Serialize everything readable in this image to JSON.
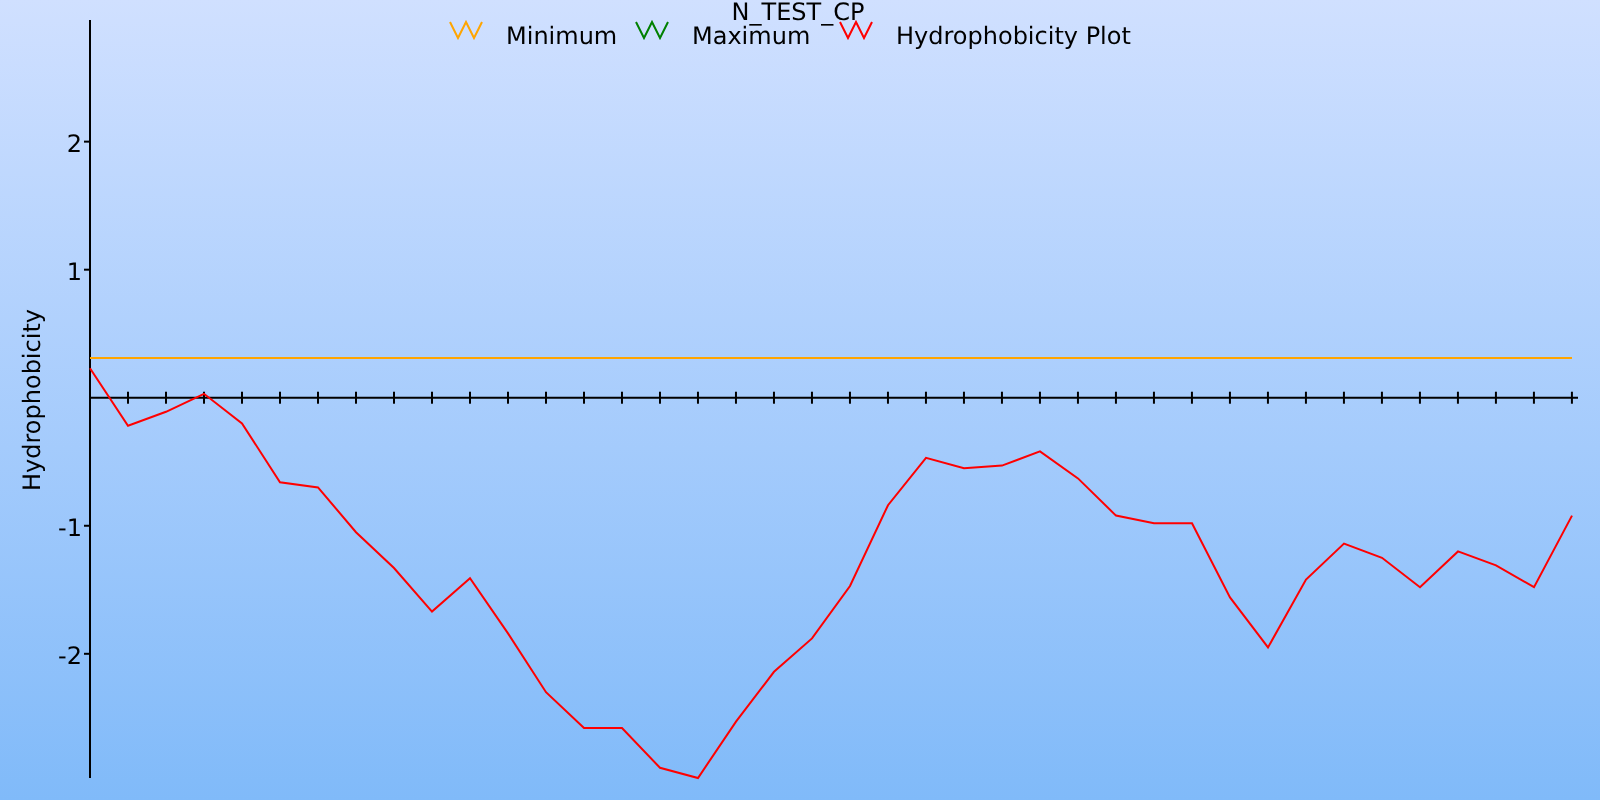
{
  "chart": {
    "chart_data": {
      "type": "line",
      "title": "N_TEST_CP",
      "ylabel": "Hydrophobicity",
      "categories": [
        null,
        null,
        null,
        null,
        null,
        null,
        null,
        null,
        null,
        null,
        null,
        null,
        null,
        null,
        null,
        null,
        null,
        null,
        null,
        null,
        null,
        null,
        null,
        null,
        null,
        null,
        null,
        null,
        null,
        null,
        null,
        null,
        null,
        null,
        null,
        null,
        null,
        null,
        null,
        null
      ],
      "series": [
        {
          "name": "Minimum",
          "color": "#ffa500",
          "values": [
            0.31,
            0.31,
            0.31,
            0.31,
            0.31,
            0.31,
            0.31,
            0.31,
            0.31,
            0.31,
            0.31,
            0.31,
            0.31,
            0.31,
            0.31,
            0.31,
            0.31,
            0.31,
            0.31,
            0.31,
            0.31,
            0.31,
            0.31,
            0.31,
            0.31,
            0.31,
            0.31,
            0.31,
            0.31,
            0.31,
            0.31,
            0.31,
            0.31,
            0.31,
            0.31,
            0.31,
            0.31,
            0.31,
            0.31,
            0.31
          ]
        },
        {
          "name": "Maximum",
          "color": "#008000",
          "values": [
            null,
            null,
            null,
            null,
            null,
            null,
            null,
            null,
            null,
            null,
            null,
            null,
            null,
            null,
            null,
            null,
            null,
            null,
            null,
            null,
            null,
            null,
            null,
            null,
            null,
            null,
            null,
            null,
            null,
            null,
            null,
            null,
            null,
            null,
            null,
            null,
            null,
            null,
            null,
            null
          ]
        },
        {
          "name": "Hydrophobicity Plot",
          "color": "#ff0000",
          "values": [
            0.23,
            -0.22,
            -0.11,
            0.03,
            -0.2,
            -0.66,
            -0.7,
            -1.05,
            -1.33,
            -1.67,
            -1.41,
            -1.84,
            -2.3,
            -2.58,
            -2.58,
            -2.89,
            -2.97,
            -2.53,
            -2.14,
            -1.88,
            -1.47,
            -0.84,
            -0.47,
            -0.55,
            -0.53,
            -0.42,
            -0.63,
            -0.92,
            -0.98,
            -0.98,
            -1.56,
            -1.95,
            -1.42,
            -1.14,
            -1.25,
            -1.48,
            -1.2,
            -1.31,
            -1.48,
            -0.92
          ]
        }
      ],
      "legend": "top",
      "ylim": [
        -2.97,
        2.95
      ],
      "yticks": [
        -2,
        -1,
        1,
        2
      ]
    }
  }
}
